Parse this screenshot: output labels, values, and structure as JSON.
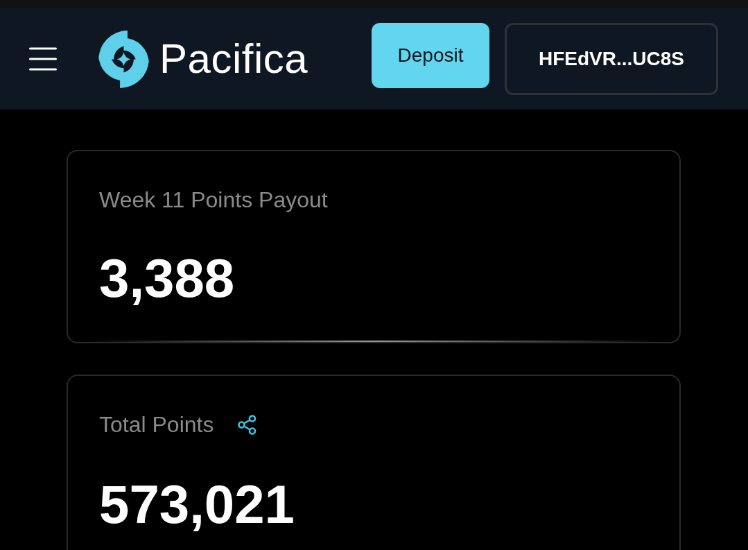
{
  "header": {
    "logo_text": "Pacifica",
    "buttons": [
      {
        "label": "Deposit",
        "kind": "primary"
      },
      {
        "label": "HFEdVR...UC8S",
        "kind": "outline"
      }
    ]
  },
  "cards": [
    {
      "label": "Week 11 Points Payout",
      "value": "3,388",
      "share": false
    },
    {
      "label": "Total Points",
      "value": "573,021",
      "share": true
    }
  ]
}
